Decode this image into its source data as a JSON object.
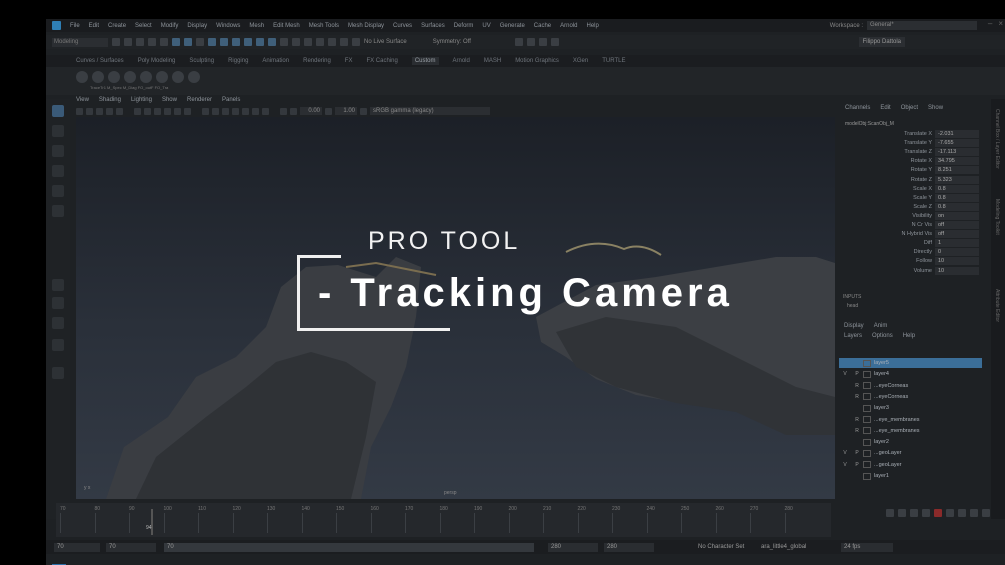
{
  "menubar": {
    "items": [
      "File",
      "Edit",
      "Create",
      "Select",
      "Modify",
      "Display",
      "Windows",
      "Mesh",
      "Edit Mesh",
      "Mesh Tools",
      "Mesh Display",
      "Curves",
      "Surfaces",
      "Deform",
      "UV",
      "Generate",
      "Cache",
      "Arnold",
      "Help"
    ],
    "workspace_label": "Workspace :",
    "workspace_value": "General*"
  },
  "statusline": {
    "mode": "Modeling",
    "live_surface": "No Live Surface",
    "symmetry": "Symmetry: Off",
    "user": "Filippo Dattola"
  },
  "shelf_tabs": [
    "Curves / Surfaces",
    "Poly Modeling",
    "Sculpting",
    "Rigging",
    "Animation",
    "Rendering",
    "FX",
    "FX Caching",
    "Custom",
    "Arnold",
    "MASH",
    "Motion Graphics",
    "XGen",
    "TURTLE"
  ],
  "shelf_active": "Custom",
  "shelf_caption": "TraceTr1 M_Spec M_Diag FO_outF FO_Tra",
  "panel_menu": [
    "View",
    "Shading",
    "Lighting",
    "Show",
    "Renderer",
    "Panels"
  ],
  "panel_bar": {
    "value_a": "0.00",
    "value_b": "1.00",
    "color_space": "sRGB gamma (legacy)"
  },
  "viewport": {
    "camera_label": "persp",
    "overlay_line1": "PRO TOOL",
    "overlay_line2": "- Tracking Camera"
  },
  "channel_box": {
    "tabs": [
      "Channels",
      "Edit",
      "Object",
      "Show"
    ],
    "object_name": "modelObj:ScanObj_M",
    "attributes": [
      {
        "name": "Translate X",
        "value": "-2.031"
      },
      {
        "name": "Translate Y",
        "value": "-7.655"
      },
      {
        "name": "Translate Z",
        "value": "-17.113"
      },
      {
        "name": "Rotate X",
        "value": "34.795"
      },
      {
        "name": "Rotate Y",
        "value": "8.251"
      },
      {
        "name": "Rotate Z",
        "value": "5.323"
      },
      {
        "name": "Scale X",
        "value": "0.8"
      },
      {
        "name": "Scale Y",
        "value": "0.8"
      },
      {
        "name": "Scale Z",
        "value": "0.8"
      },
      {
        "name": "Visibility",
        "value": "on"
      },
      {
        "name": "N Cr Vis",
        "value": "off"
      },
      {
        "name": "N Hybrid Vis",
        "value": "off"
      },
      {
        "name": "Diff",
        "value": "1"
      },
      {
        "name": "Directly",
        "value": "0"
      },
      {
        "name": "Follow",
        "value": "10"
      },
      {
        "name": "Volume",
        "value": "10"
      }
    ],
    "inputs_label": "INPUTS",
    "inputs_item": "head"
  },
  "layer_editor": {
    "tabs_top": [
      "Display",
      "Anim"
    ],
    "tabs": [
      "Layers",
      "Options",
      "Help"
    ],
    "layers": [
      {
        "v": "",
        "p": "",
        "name": "layer5",
        "selected": true
      },
      {
        "v": "V",
        "p": "P",
        "name": "layer4",
        "selected": false
      },
      {
        "v": "",
        "p": "R",
        "name": "...eyeCorneas",
        "selected": false
      },
      {
        "v": "",
        "p": "R",
        "name": "...eyeCorneas",
        "selected": false
      },
      {
        "v": "",
        "p": "",
        "name": "layer3",
        "selected": false
      },
      {
        "v": "",
        "p": "R",
        "name": "...eye_membranes",
        "selected": false
      },
      {
        "v": "",
        "p": "R",
        "name": "...eye_membranes",
        "selected": false
      },
      {
        "v": "",
        "p": "",
        "name": "layer2",
        "selected": false
      },
      {
        "v": "V",
        "p": "P",
        "name": "...geoLayer",
        "selected": false
      },
      {
        "v": "V",
        "p": "P",
        "name": "...geoLayer",
        "selected": false
      },
      {
        "v": "",
        "p": "",
        "name": "layer1",
        "selected": false
      }
    ]
  },
  "side_strip": [
    "Channel Box / Layer Editor",
    "Modeling Toolkit",
    "Attribute Editor"
  ],
  "time_slider": {
    "ticks": [
      "70",
      "80",
      "90",
      "100",
      "110",
      "120",
      "130",
      "140",
      "150",
      "160",
      "170",
      "180",
      "190",
      "200",
      "210",
      "220",
      "230",
      "240",
      "250",
      "260",
      "270",
      "280"
    ],
    "current_frame": "94"
  },
  "range_bar": {
    "start": "70",
    "start_inner": "70",
    "range_label": "70",
    "end_inner": "280",
    "end": "280",
    "end_outer": "280",
    "character_set": "No Character Set",
    "anim_layer": "ara_little4_global",
    "fps": "24 fps"
  }
}
